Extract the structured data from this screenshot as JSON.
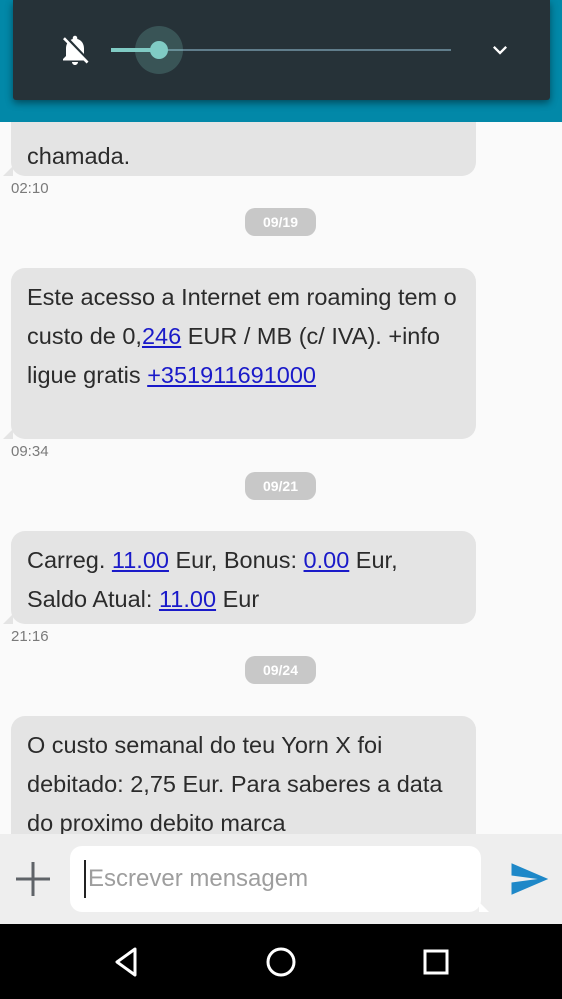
{
  "volume_panel": {
    "level": 0.14,
    "icons": {
      "mute": "notifications-off-icon",
      "expand": "chevron-down-icon"
    }
  },
  "messages": [
    {
      "parts": [
        {
          "text": "chamada."
        }
      ],
      "time": "02:10"
    },
    {
      "date": "09/19"
    },
    {
      "parts": [
        {
          "text": "Este acesso a Internet em roaming tem o custo de 0,"
        },
        {
          "text": "246",
          "link": true
        },
        {
          "text": " EUR / MB (c/ IVA). +info ligue gratis "
        },
        {
          "text": "+351911691000",
          "link": true
        }
      ],
      "time": "09:34"
    },
    {
      "date": "09/21"
    },
    {
      "parts": [
        {
          "text": "Carreg. "
        },
        {
          "text": "11.00",
          "link": true
        },
        {
          "text": " Eur, Bonus: "
        },
        {
          "text": "0.00",
          "link": true
        },
        {
          "text": " Eur, Saldo Atual: "
        },
        {
          "text": "11.00",
          "link": true
        },
        {
          "text": " Eur"
        }
      ],
      "time": "21:16"
    },
    {
      "date": "09/24"
    },
    {
      "parts": [
        {
          "text": "O custo semanal do teu Yorn X foi debitado: 2,75 Eur. Para saberes a data do proximo debito marca"
        }
      ]
    }
  ],
  "compose": {
    "placeholder": "Escrever mensagem",
    "value": "",
    "icons": {
      "add": "add-icon",
      "send": "send-icon"
    }
  },
  "navbar": {
    "icons": [
      "back-icon",
      "home-icon",
      "recent-apps-icon"
    ]
  },
  "colors": {
    "accent": "#0288a8",
    "panel": "#263238",
    "slider": "#80cbc4",
    "bubble": "#e4e4e4",
    "link": "#1a1ac9",
    "send": "#1e88c8"
  }
}
